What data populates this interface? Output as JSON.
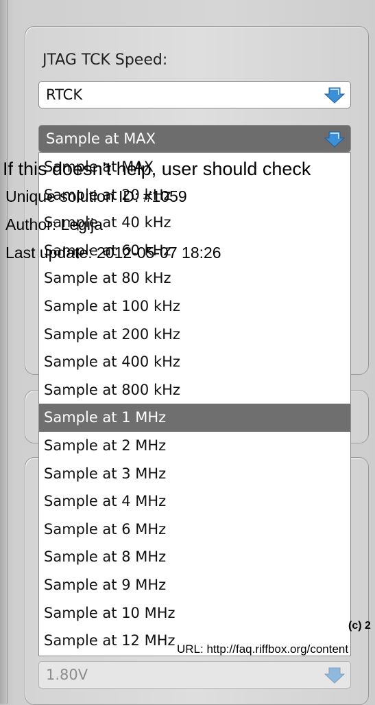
{
  "config": {
    "speed_label": "JTAG TCK Speed:",
    "speed_combo": {
      "value": "RTCK"
    },
    "sample_combo": {
      "value": "Sample at MAX"
    },
    "voltage_combo": {
      "value": "1.80V"
    }
  },
  "dropdown": {
    "options": [
      "Sample at MAX",
      "Sample at 20 kHz",
      "Sample at 40 kHz",
      "Sample at 60 kHz",
      "Sample at 80 kHz",
      "Sample at 100 kHz",
      "Sample at 200 kHz",
      "Sample at 400 kHz",
      "Sample at 800 kHz",
      "Sample at 1 MHz",
      "Sample at 2 MHz",
      "Sample at 3 MHz",
      "Sample at 4 MHz",
      "Sample at 6 MHz",
      "Sample at 8 MHz",
      "Sample at 9 MHz",
      "Sample at 10 MHz",
      "Sample at 12 MHz"
    ],
    "highlighted": "Sample at 1 MHz"
  },
  "overlay": {
    "help_line": "If this doesn't help, user should check",
    "solution_id": "Unique solution ID: #1059",
    "author": "Author: Legija",
    "last_update": "Last update: 2012-05-07 18:26",
    "copyright": "(c) 2",
    "url": "URL: http://faq.riffbox.org/content"
  },
  "colors": {
    "arrow_blue": "#3d8fd8",
    "highlight": "#6f6f6f"
  }
}
